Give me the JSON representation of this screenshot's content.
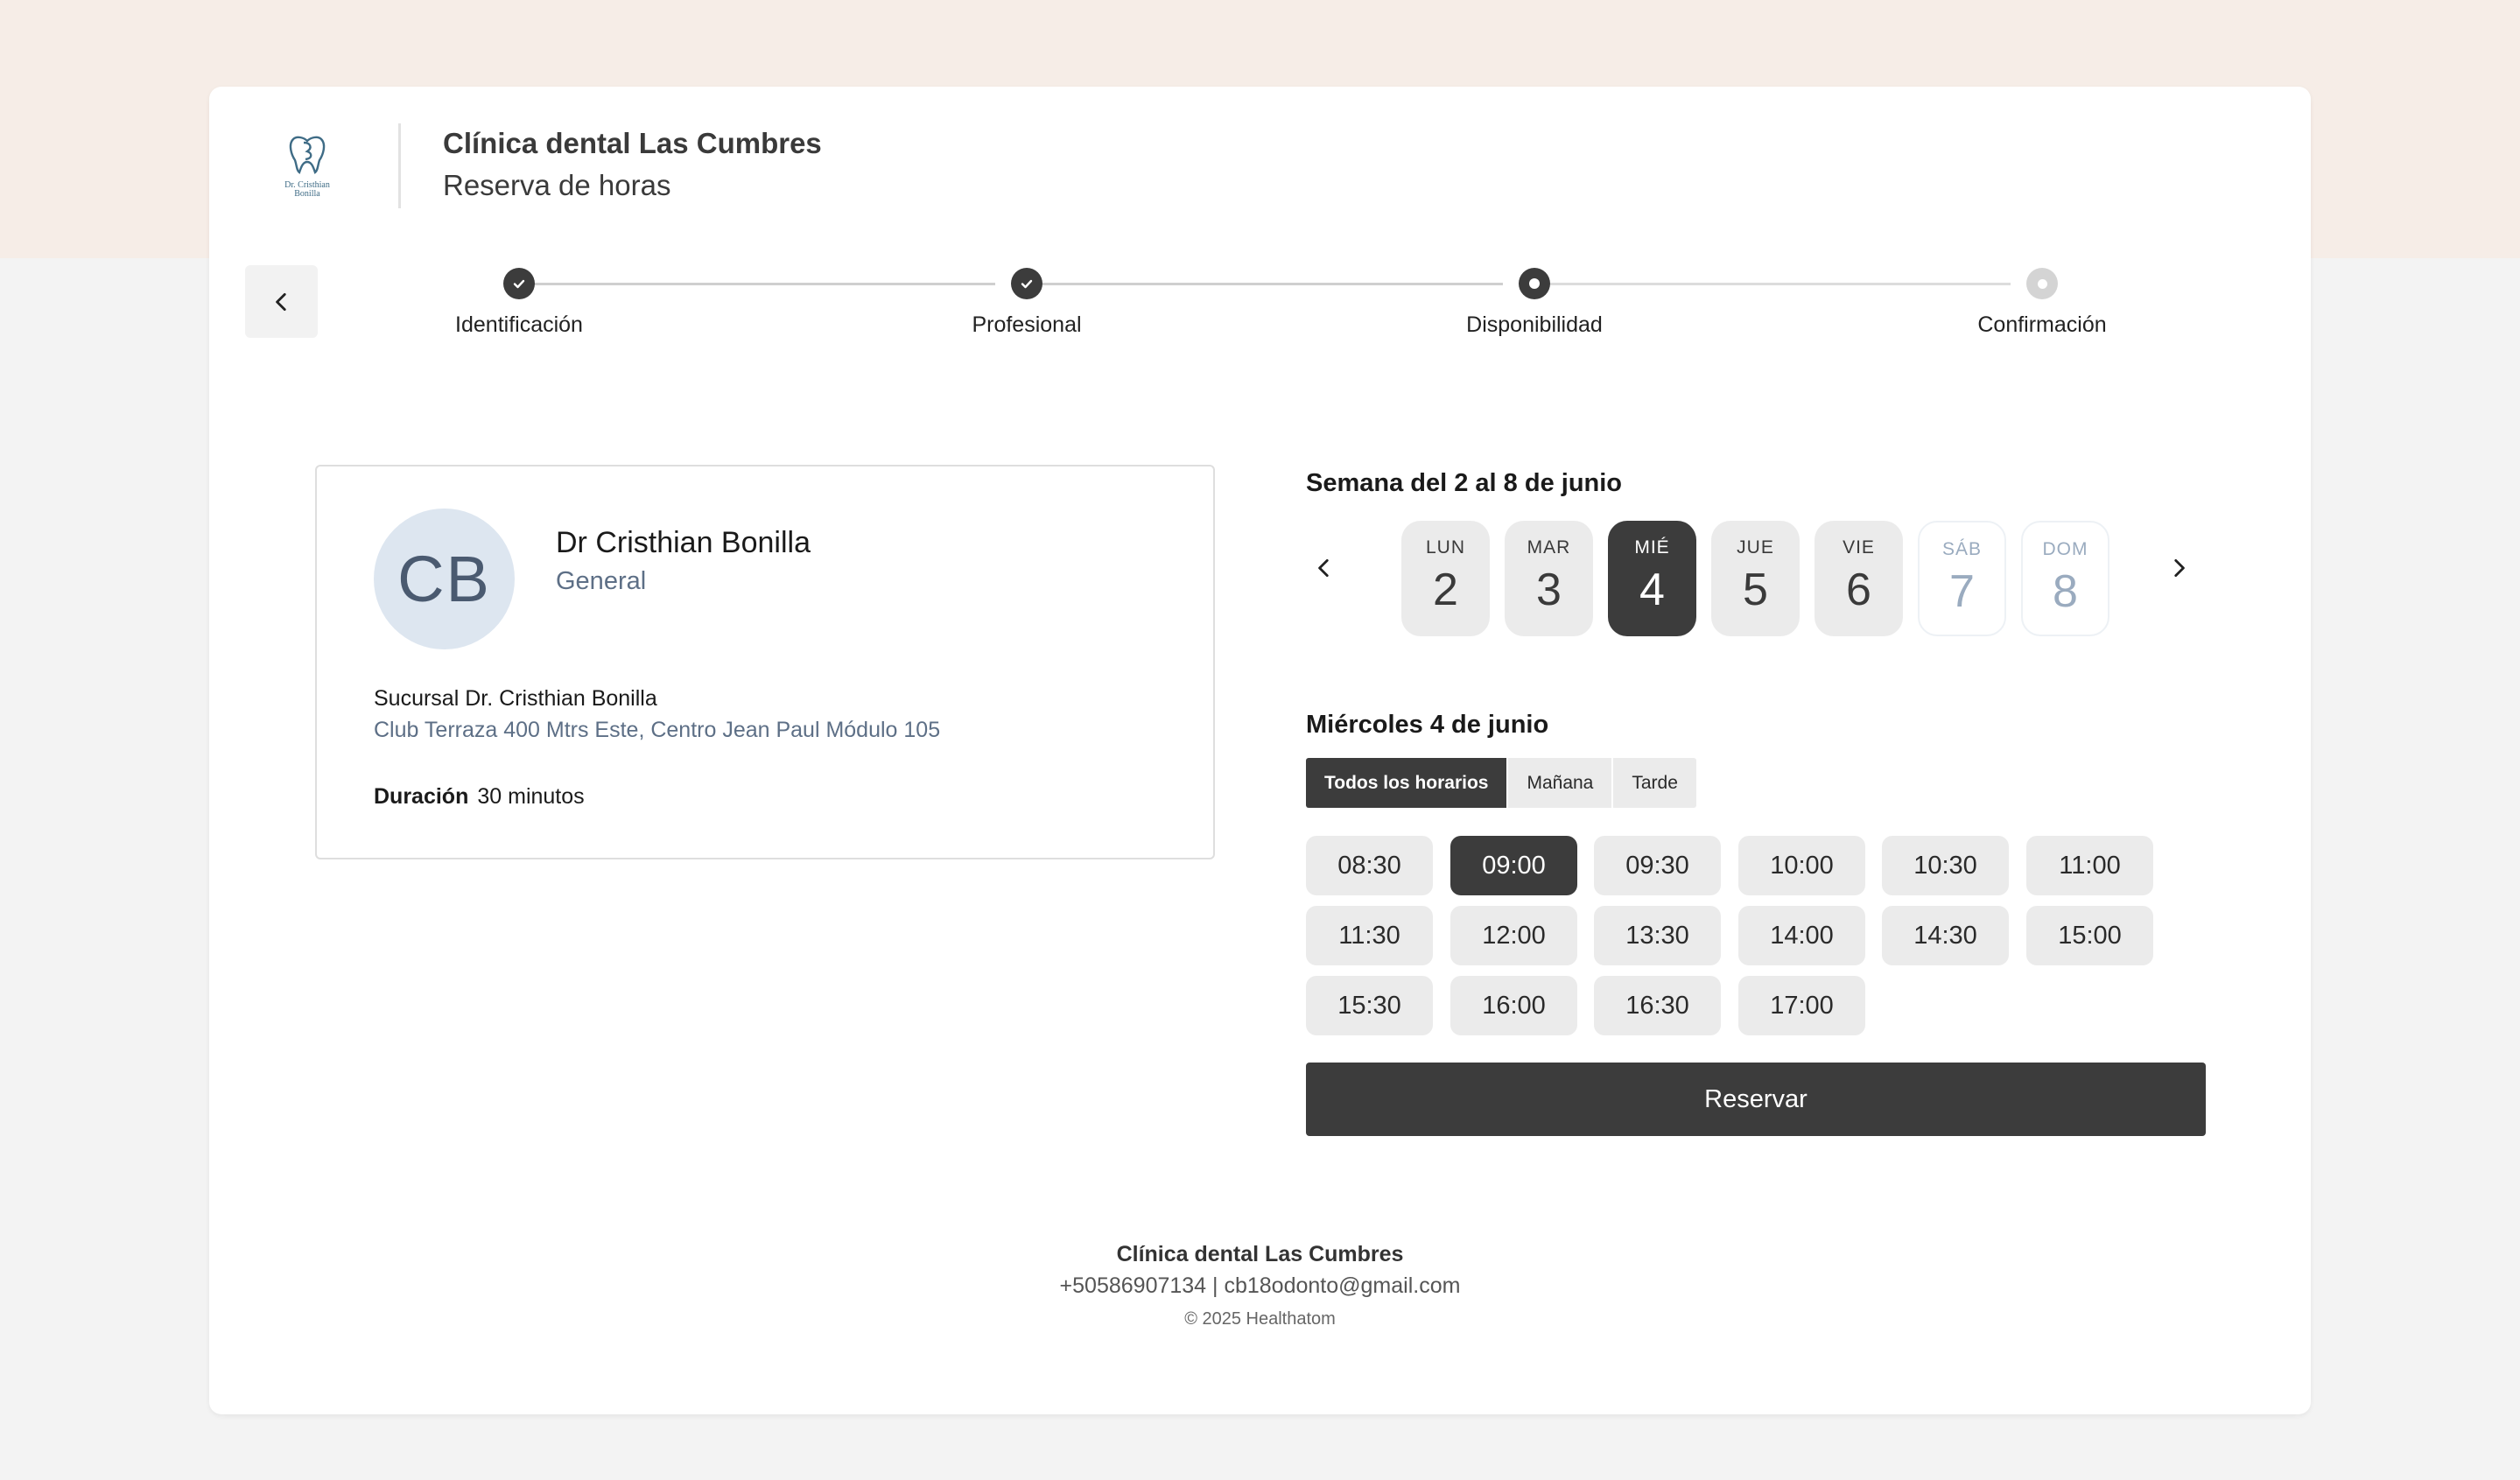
{
  "header": {
    "clinic_name": "Clínica dental Las Cumbres",
    "subtitle": "Reserva de horas",
    "logo_text_line1": "Dr. Cristhian",
    "logo_text_line2": "Bonilla"
  },
  "stepper": {
    "steps": [
      {
        "label": "Identificación",
        "status": "done"
      },
      {
        "label": "Profesional",
        "status": "done"
      },
      {
        "label": "Disponibilidad",
        "status": "current"
      },
      {
        "label": "Confirmación",
        "status": "pending"
      }
    ]
  },
  "professional": {
    "initials": "CB",
    "name": "Dr Cristhian Bonilla",
    "specialty": "General",
    "branch_name": "Sucursal Dr. Cristhian Bonilla",
    "branch_address": "Club Terraza 400 Mtrs Este, Centro Jean Paul Módulo 105",
    "duration_label": "Duración",
    "duration_value": "30 minutos"
  },
  "calendar": {
    "week_title": "Semana del 2 al 8 de junio",
    "days": [
      {
        "name": "LUN",
        "num": "2",
        "state": "available"
      },
      {
        "name": "MAR",
        "num": "3",
        "state": "available"
      },
      {
        "name": "MIÉ",
        "num": "4",
        "state": "selected"
      },
      {
        "name": "JUE",
        "num": "5",
        "state": "available"
      },
      {
        "name": "VIE",
        "num": "6",
        "state": "available"
      },
      {
        "name": "SÁB",
        "num": "7",
        "state": "disabled"
      },
      {
        "name": "DOM",
        "num": "8",
        "state": "disabled"
      }
    ],
    "selected_date_title": "Miércoles 4 de junio"
  },
  "filters": [
    {
      "label": "Todos los horarios",
      "active": true
    },
    {
      "label": "Mañana",
      "active": false
    },
    {
      "label": "Tarde",
      "active": false
    }
  ],
  "slots": [
    {
      "time": "08:30",
      "selected": false
    },
    {
      "time": "09:00",
      "selected": true
    },
    {
      "time": "09:30",
      "selected": false
    },
    {
      "time": "10:00",
      "selected": false
    },
    {
      "time": "10:30",
      "selected": false
    },
    {
      "time": "11:00",
      "selected": false
    },
    {
      "time": "11:30",
      "selected": false
    },
    {
      "time": "12:00",
      "selected": false
    },
    {
      "time": "13:30",
      "selected": false
    },
    {
      "time": "14:00",
      "selected": false
    },
    {
      "time": "14:30",
      "selected": false
    },
    {
      "time": "15:00",
      "selected": false
    },
    {
      "time": "15:30",
      "selected": false
    },
    {
      "time": "16:00",
      "selected": false
    },
    {
      "time": "16:30",
      "selected": false
    },
    {
      "time": "17:00",
      "selected": false
    }
  ],
  "actions": {
    "reserve_label": "Reservar"
  },
  "footer": {
    "clinic_name": "Clínica dental Las Cumbres",
    "contact": "+50586907134 | cb18odonto@gmail.com",
    "copyright": "© 2025 Healthatom"
  },
  "colors": {
    "accent_dark": "#3c3c3c",
    "top_band": "#f6ede7",
    "muted_blue": "#5d6f86",
    "avatar_bg": "#dde6f0"
  },
  "icons": {
    "back": "chevron-left-icon",
    "prev_week": "chevron-left-icon",
    "next_week": "chevron-right-icon",
    "step_done": "check-icon",
    "logo": "tooth-logo-icon"
  }
}
